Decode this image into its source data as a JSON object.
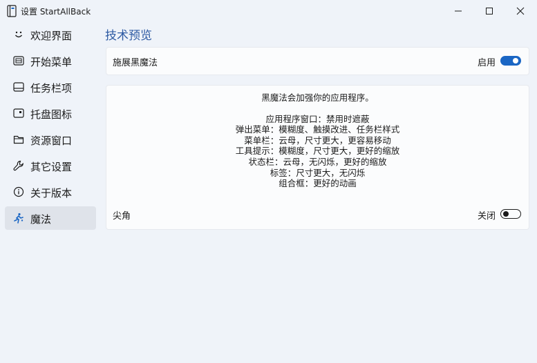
{
  "window": {
    "title": "设置 StartAllBack",
    "icon": "app-book-icon",
    "controls": [
      "minimize-icon",
      "maximize-icon",
      "close-icon"
    ]
  },
  "sidebar": {
    "items": [
      {
        "label": "欢迎界面",
        "icon": "smile-icon"
      },
      {
        "label": "开始菜单",
        "icon": "start-menu-icon"
      },
      {
        "label": "任务栏项",
        "icon": "taskbar-icon"
      },
      {
        "label": "托盘图标",
        "icon": "tray-icon"
      },
      {
        "label": "资源窗口",
        "icon": "folder-icon"
      },
      {
        "label": "其它设置",
        "icon": "wrench-icon"
      },
      {
        "label": "关于版本",
        "icon": "info-icon"
      },
      {
        "label": "魔法",
        "icon": "magic-runner-icon",
        "active": true
      }
    ]
  },
  "main": {
    "title": "技术预览",
    "magic_toggle": {
      "label": "施展黑魔法",
      "state_label": "启用",
      "on": true
    },
    "description": {
      "intro": "黑魔法会加强你的应用程序。",
      "lines": [
        "应用程序窗口：禁用时遮蔽",
        "弹出菜单：模糊度、触摸改进、任务栏样式",
        "菜单栏：云母，尺寸更大，更容易移动",
        "工具提示：模糊度，尺寸更大，更好的缩放",
        "状态栏：云母，无闪烁，更好的缩放",
        "标签：尺寸更大，无闪烁",
        "组合框：更好的动画"
      ]
    },
    "sharp_corners_toggle": {
      "label": "尖角",
      "state_label": "关闭",
      "on": false
    }
  },
  "colors": {
    "background": "#eff3f9",
    "card": "#fbfcfd",
    "accent": "#1a66c4",
    "title_blue": "#2d5aa3",
    "active_nav": "#dfe3ea"
  }
}
